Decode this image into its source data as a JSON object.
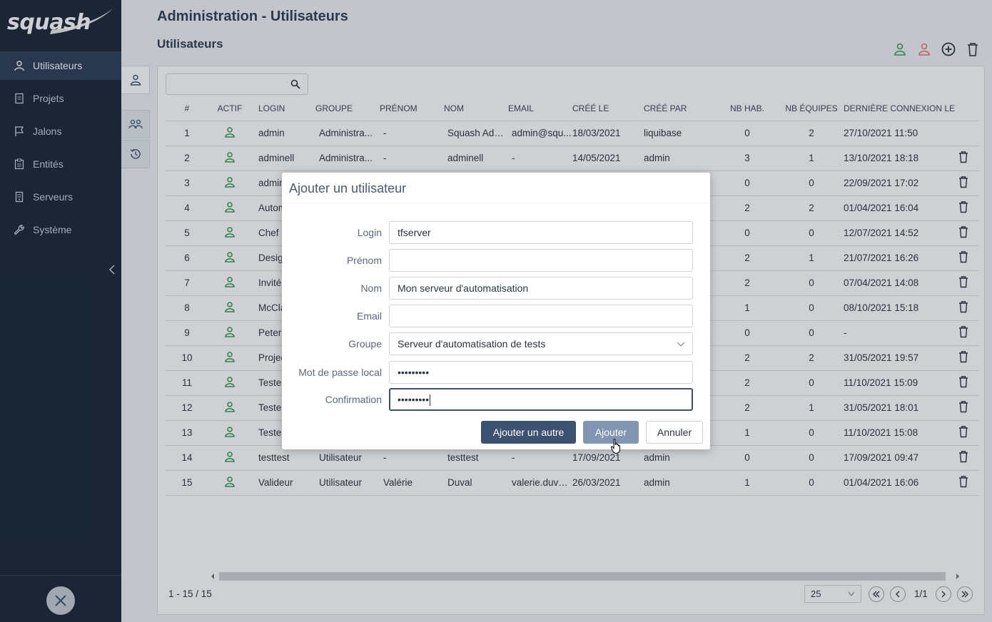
{
  "sidebar": {
    "logo": "squash",
    "items": [
      {
        "label": "Utilisateurs",
        "icon": "user-icon"
      },
      {
        "label": "Projets",
        "icon": "document-icon"
      },
      {
        "label": "Jalons",
        "icon": "flag-icon"
      },
      {
        "label": "Entités",
        "icon": "clipboard-icon"
      },
      {
        "label": "Serveurs",
        "icon": "server-icon"
      },
      {
        "label": "Système",
        "icon": "wrench-icon"
      }
    ]
  },
  "header": {
    "title": "Administration - Utilisateurs",
    "section": "Utilisateurs"
  },
  "search": {
    "value": ""
  },
  "table": {
    "columns": [
      "#",
      "ACTIF",
      "LOGIN",
      "GROUPE",
      "PRÉNOM",
      "NOM",
      "EMAIL",
      "CRÉÉ LE",
      "CRÉÉ PAR",
      "NB HAB.",
      "NB ÉQUIPES",
      "DERNIÈRE CONNEXION LE"
    ],
    "rows": [
      [
        "1",
        "admin",
        "Administra...",
        "-",
        "Squash Adm...",
        "admin@squ...",
        "18/03/2021",
        "liquibase",
        "0",
        "2",
        "27/10/2021 11:50"
      ],
      [
        "2",
        "adminell",
        "Administra...",
        "-",
        "adminell",
        "-",
        "14/05/2021",
        "admin",
        "3",
        "1",
        "13/10/2021 18:18"
      ],
      [
        "3",
        "adminl",
        "",
        "",
        "",
        "",
        "",
        "",
        "0",
        "0",
        "22/09/2021 17:02"
      ],
      [
        "4",
        "Automa",
        "",
        "",
        "",
        "",
        "",
        "",
        "2",
        "2",
        "01/04/2021 16:04"
      ],
      [
        "5",
        "Chef de",
        "",
        "",
        "",
        "",
        "",
        "",
        "0",
        "0",
        "12/07/2021 14:52"
      ],
      [
        "6",
        "Designe",
        "",
        "",
        "",
        "",
        "",
        "",
        "2",
        "1",
        "21/07/2021 16:26"
      ],
      [
        "7",
        "Invité",
        "",
        "",
        "",
        "",
        "",
        "",
        "2",
        "0",
        "07/04/2021 14:08"
      ],
      [
        "8",
        "McClan",
        "",
        "",
        "",
        "",
        "",
        "",
        "1",
        "0",
        "08/10/2021 15:18"
      ],
      [
        "9",
        "Peter",
        "",
        "",
        "",
        "",
        "",
        "",
        "0",
        "0",
        "-"
      ],
      [
        "10",
        "Project",
        "",
        "",
        "",
        "",
        "",
        "",
        "2",
        "2",
        "31/05/2021 19:57"
      ],
      [
        "11",
        "Testeur",
        "",
        "",
        "",
        "",
        "",
        "",
        "2",
        "0",
        "11/10/2021 15:09"
      ],
      [
        "12",
        "Testeur",
        "",
        "",
        "",
        "",
        "",
        "",
        "2",
        "1",
        "31/05/2021 18:01"
      ],
      [
        "13",
        "Testeur",
        "",
        "",
        "",
        "",
        "",
        "",
        "1",
        "0",
        "11/10/2021 15:08"
      ],
      [
        "14",
        "testtest",
        "Utilisateur",
        "-",
        "testtest",
        "-",
        "17/09/2021",
        "admin",
        "0",
        "0",
        "17/09/2021 09:47"
      ],
      [
        "15",
        "Valideur",
        "Utilisateur",
        "Valérie",
        "Duval",
        "valerie.duval...",
        "26/03/2021",
        "admin",
        "1",
        "0",
        "01/04/2021 16:06"
      ]
    ]
  },
  "pagination": {
    "range": "1 - 15 / 15",
    "page_size": "25",
    "current": "1/1"
  },
  "dialog": {
    "title": "Ajouter un utilisateur",
    "fields": {
      "login": {
        "label": "Login",
        "value": "tfserver"
      },
      "prenom": {
        "label": "Prénom",
        "value": ""
      },
      "nom": {
        "label": "Nom",
        "value": "Mon serveur d'automatisation"
      },
      "email": {
        "label": "Email",
        "value": ""
      },
      "groupe": {
        "label": "Groupe",
        "value": "Serveur d'automatisation de tests"
      },
      "password": {
        "label": "Mot de passe local",
        "value": "•••••••••"
      },
      "confirm": {
        "label": "Confirmation",
        "value": "•••••••••"
      }
    },
    "buttons": {
      "add_another": "Ajouter un autre",
      "add": "Ajouter",
      "cancel": "Annuler"
    }
  },
  "colors": {
    "sidebar_bg": "#1a2535",
    "active_green": "#3a9a5b",
    "delete_red": "#e0767a",
    "primary_button": "#3d5170"
  }
}
